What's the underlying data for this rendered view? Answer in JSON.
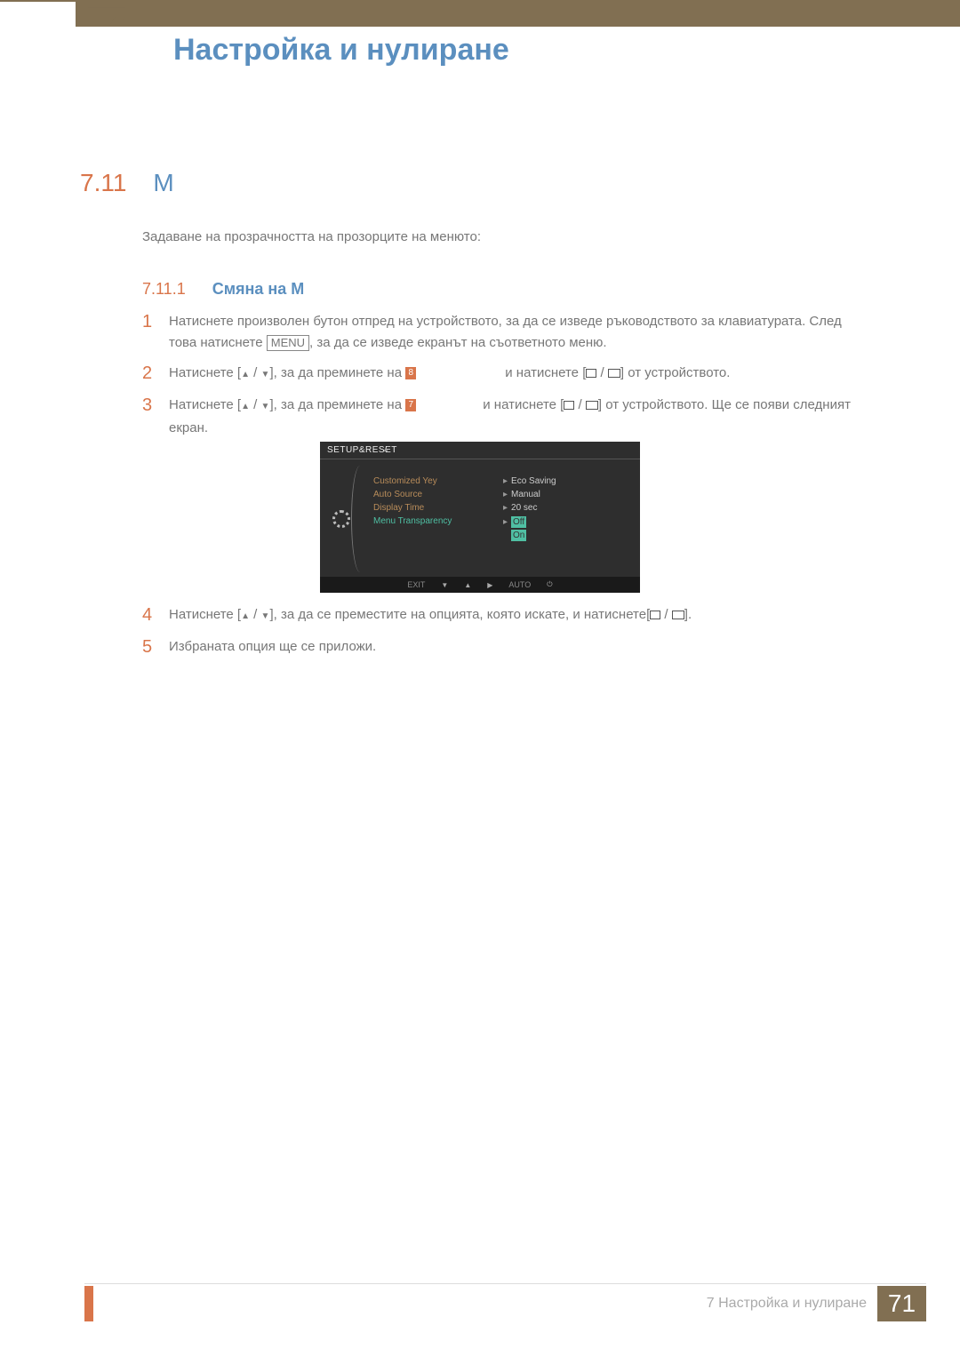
{
  "chapter_big_num": "7",
  "chapter_title": "Настройка и нулиране",
  "section": {
    "num": "7.11",
    "title_garbled": "M"
  },
  "intro_line": "Задаване на прозрачността на прозорците на менюто:",
  "subsection": {
    "num": "7.11.1",
    "title": "Смяна на M"
  },
  "steps": {
    "s1_a": "Натиснете произволен бутон отпред на устройството, за да се изведе ръководството за клавиатурата. След това натиснете ",
    "s1_menu": "MENU",
    "s1_b": ", за да се изведе екранът на съответното меню.",
    "s2_a": "Натиснете [",
    "s2_sep": " / ",
    "s2_b": "], за да преминете на ",
    "s2_c": " и натиснете [",
    "s2_d": "] от устройството.",
    "s3_a": "Натиснете [",
    "s3_b": "], за да преминете на ",
    "s3_c": " и натиснете [",
    "s3_d": "] от устройството. Ще се появи следният екран.",
    "s4_a": "Натиснете [",
    "s4_b": "], за да се преместите на опцията, която искате, и натиснете[",
    "s4_c": "].",
    "s5": "Избраната опция ще се приложи.",
    "glyph2": "8",
    "glyph3": "7"
  },
  "osd": {
    "title": "SETUP&RESET",
    "items": [
      "Customized Yey",
      "Auto Source",
      "Display Time",
      "Menu Transparency"
    ],
    "values": [
      "Eco Saving",
      "Manual",
      "20 sec"
    ],
    "options": [
      "Off",
      "On"
    ],
    "footer": {
      "exit": "EXIT",
      "auto": "AUTO"
    }
  },
  "footer": {
    "chapter_label": "7 Настройка и нулиране",
    "page": "71"
  }
}
